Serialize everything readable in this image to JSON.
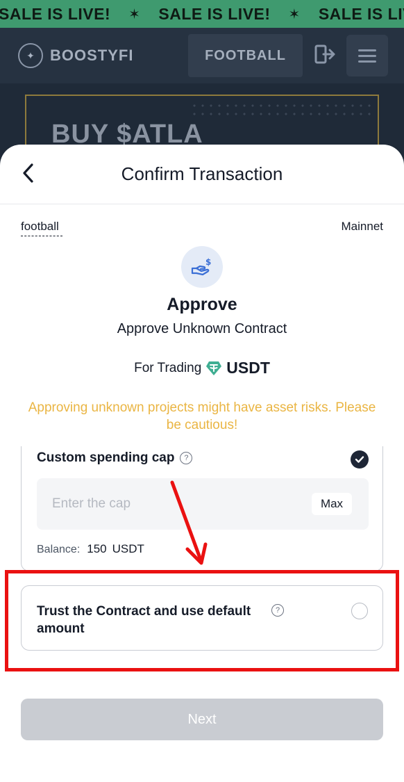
{
  "ticker": {
    "items": [
      "SALE IS LIVE!",
      "SALE IS LIVE!",
      "SALE IS LIVE!"
    ],
    "star": "✶"
  },
  "site": {
    "brand": "BOOSTYFI",
    "network_pill": "FOOTBALL",
    "banner_text": "BUY $ATLA",
    "icons": {
      "logo": "star-logo-icon",
      "logout": "logout-icon",
      "menu": "hamburger-menu-icon"
    }
  },
  "sheet": {
    "title": "Confirm Transaction",
    "source": "football",
    "network": "Mainnet",
    "action_title": "Approve",
    "action_subtitle": "Approve Unknown Contract",
    "trading_label": "For Trading",
    "token": "USDT",
    "warning": "Approving unknown projects might have asset risks. Please be cautious!",
    "custom_cap": {
      "title": "Custom spending cap",
      "placeholder": "Enter the cap",
      "value": "",
      "max_label": "Max",
      "balance_label": "Balance:",
      "balance_value": "150",
      "balance_unit": "USDT",
      "selected": true
    },
    "trust_option": {
      "label": "Trust the Contract and use default amount",
      "selected": false
    },
    "next_label": "Next"
  },
  "colors": {
    "ticker_bg": "#3f9a6f",
    "site_bg": "#1f2a38",
    "warning": "#eab543",
    "highlight": "#ea1111",
    "next_disabled": "#c9ccd2",
    "usdt": "#3fae92"
  }
}
